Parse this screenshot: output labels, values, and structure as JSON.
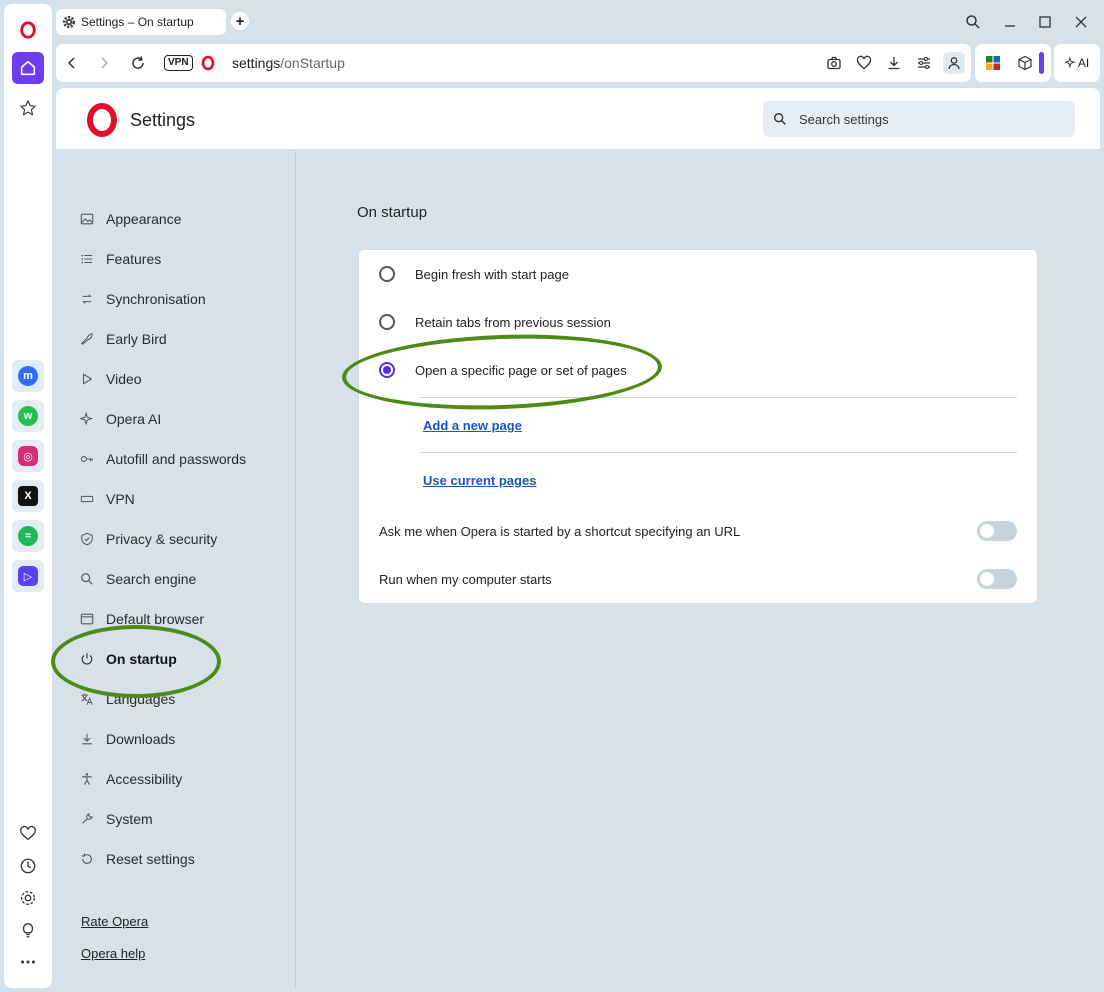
{
  "tab": {
    "title": "Settings – On startup",
    "new_tab": "+"
  },
  "address": {
    "vpn": "VPN",
    "url_host": "settings",
    "url_path": "/onStartup"
  },
  "ai_button": {
    "label": "AI"
  },
  "header": {
    "title": "Settings",
    "search_placeholder": "Search settings"
  },
  "nav": {
    "items": [
      {
        "label": "Appearance"
      },
      {
        "label": "Features"
      },
      {
        "label": "Synchronisation"
      },
      {
        "label": "Early Bird"
      },
      {
        "label": "Video"
      },
      {
        "label": "Opera AI"
      },
      {
        "label": "Autofill and passwords"
      },
      {
        "label": "VPN"
      },
      {
        "label": "Privacy & security"
      },
      {
        "label": "Search engine"
      },
      {
        "label": "Default browser"
      },
      {
        "label": "On startup"
      },
      {
        "label": "Languages"
      },
      {
        "label": "Downloads"
      },
      {
        "label": "Accessibility"
      },
      {
        "label": "System"
      },
      {
        "label": "Reset settings"
      }
    ],
    "rate": "Rate Opera",
    "help": "Opera help"
  },
  "main": {
    "title": "On startup",
    "options": [
      {
        "label": "Begin fresh with start page",
        "selected": false
      },
      {
        "label": "Retain tabs from previous session",
        "selected": false
      },
      {
        "label": "Open a specific page or set of pages",
        "selected": true
      }
    ],
    "add_page": "Add a new page",
    "use_current": "Use current pages",
    "toggles": [
      {
        "label": "Ask me when Opera is started by a shortcut specifying an URL",
        "on": false
      },
      {
        "label": "Run when my computer starts",
        "on": false
      }
    ]
  },
  "colors": {
    "accent": "#5b2ce8",
    "annotation": "#4d8b17",
    "link": "#1a56c8"
  }
}
